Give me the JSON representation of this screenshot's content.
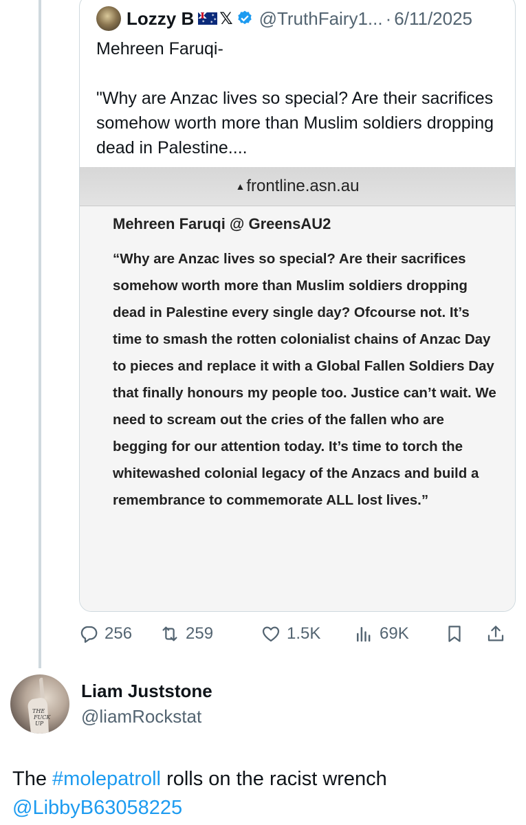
{
  "quoted_tweet": {
    "author_name": "Lozzy B",
    "author_flag_icon": "australia-flag-icon",
    "author_x_badge": "𝕏",
    "author_verified_icon": "verified-badge-icon",
    "author_handle": "@TruthFairy1...",
    "separator": "·",
    "date": "6/11/2025",
    "text": "Mehreen Faruqi-\n\n\"Why are Anzac lives so special? Are their sacrifices somehow worth more than Muslim soldiers dropping dead in Palestine....",
    "image": {
      "url_bar": "frontline.asn.au",
      "title": "Mehreen Faruqi @ GreensAU2",
      "body": "“Why are Anzac lives so special? Are their sacrifices somehow worth more than Muslim soldiers dropping dead in Palestine every single day?  Ofcourse not. It’s time to smash the rotten colonialist chains of Anzac Day to pieces and replace it with a Global Fallen Soldiers Day that finally honours my people too. Justice can’t wait. We need to scream out the cries of the fallen who are begging for our attention today. It’s time to torch the whitewashed colonial legacy of the Anzacs and build a remembrance to commemorate ALL lost lives.”"
    }
  },
  "actions": {
    "replies": "256",
    "reposts": "259",
    "likes": "1.5K",
    "views": "69K",
    "icons": [
      "reply-icon",
      "repost-icon",
      "like-icon",
      "views-icon",
      "bookmark-icon",
      "share-icon"
    ]
  },
  "reply": {
    "author_name": "Liam Juststone",
    "author_handle": "@liamRockstat",
    "text_before": "The ",
    "hashtag": "#molepatroll",
    "text_after": " rolls on the racist wrench",
    "mention": "@LibbyB63058225"
  },
  "colors": {
    "link": "#1d9bf0",
    "muted": "#536471",
    "text": "#0f1419",
    "border": "#cfd9de"
  }
}
